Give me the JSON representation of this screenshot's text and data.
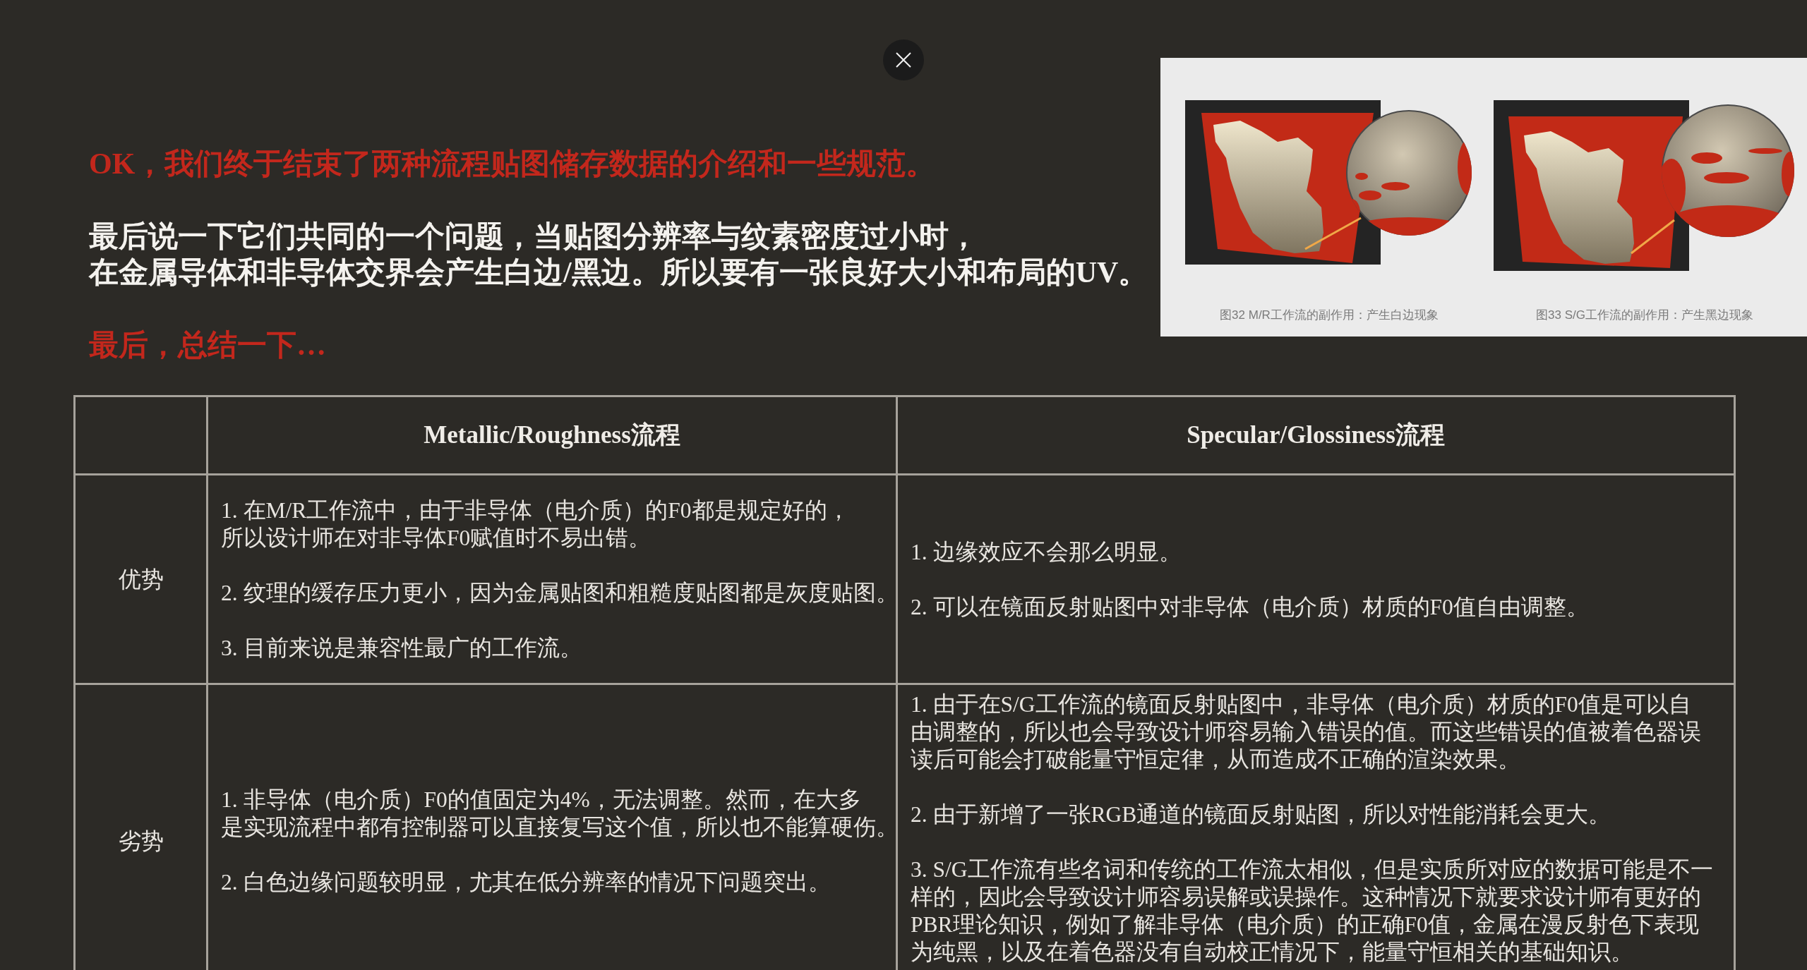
{
  "intro": [
    {
      "kind": "heading",
      "lines": [
        "OK，我们终于结束了两种流程贴图储存数据的介绍和一些规范。"
      ]
    },
    {
      "kind": "paragraph",
      "lines": [
        "最后说一下它们共同的一个问题，当贴图分辨率与纹素密度过小时，",
        "在金属导体和非导体交界会产生白边/黑边。所以要有一张良好大小和布局的UV。"
      ]
    },
    {
      "kind": "heading",
      "lines": [
        "最后，总结一下…"
      ]
    }
  ],
  "figures": [
    {
      "caption": "图32 M/R工作流的副作用：产生白边现象"
    },
    {
      "caption": "图33 S/G工作流的副作用：产生黑边现象"
    }
  ],
  "table": {
    "columns": [
      "Metallic/Roughness流程",
      "Specular/Glossiness流程"
    ],
    "rows": [
      {
        "label": "优势",
        "cells": [
          [
            [
              "1. 在M/R工作流中，由于非导体（电介质）的F0都是规定好的，",
              "所以设计师在对非导体F0赋值时不易出错。"
            ],
            [
              "2. 纹理的缓存压力更小，因为金属贴图和粗糙度贴图都是灰度贴图。"
            ],
            [
              "3. 目前来说是兼容性最广的工作流。"
            ]
          ],
          [
            [
              "1. 边缘效应不会那么明显。"
            ],
            [
              "2. 可以在镜面反射贴图中对非导体（电介质）材质的F0值自由调整。"
            ]
          ]
        ]
      },
      {
        "label": "劣势",
        "cells": [
          [
            [
              "1. 非导体（电介质）F0的值固定为4%，无法调整。然而，在大多",
              "是实现流程中都有控制器可以直接复写这个值，所以也不能算硬伤。"
            ],
            [
              "2. 白色边缘问题较明显，尤其在低分辨率的情况下问题突出。"
            ]
          ],
          [
            [
              "1. 由于在S/G工作流的镜面反射贴图中，非导体（电介质）材质的F0值是可以自",
              "由调整的，所以也会导致设计师容易输入错误的值。而这些错误的值被着色器误",
              "读后可能会打破能量守恒定律，从而造成不正确的渲染效果。"
            ],
            [
              "2. 由于新增了一张RGB通道的镜面反射贴图，所以对性能消耗会更大。"
            ],
            [
              "3. S/G工作流有些名词和传统的工作流太相似，但是实质所对应的数据可能是不一",
              "样的，因此会导致设计师容易误解或误操作。这种情况下就要求设计师有更好的",
              "PBR理论知识，例如了解非导体（电介质）的正确F0值，金属在漫反射色下表现",
              "为纯黑，以及在着色器没有自动校正情况下，能量守恒相关的基础知识。"
            ]
          ]
        ]
      }
    ]
  }
}
